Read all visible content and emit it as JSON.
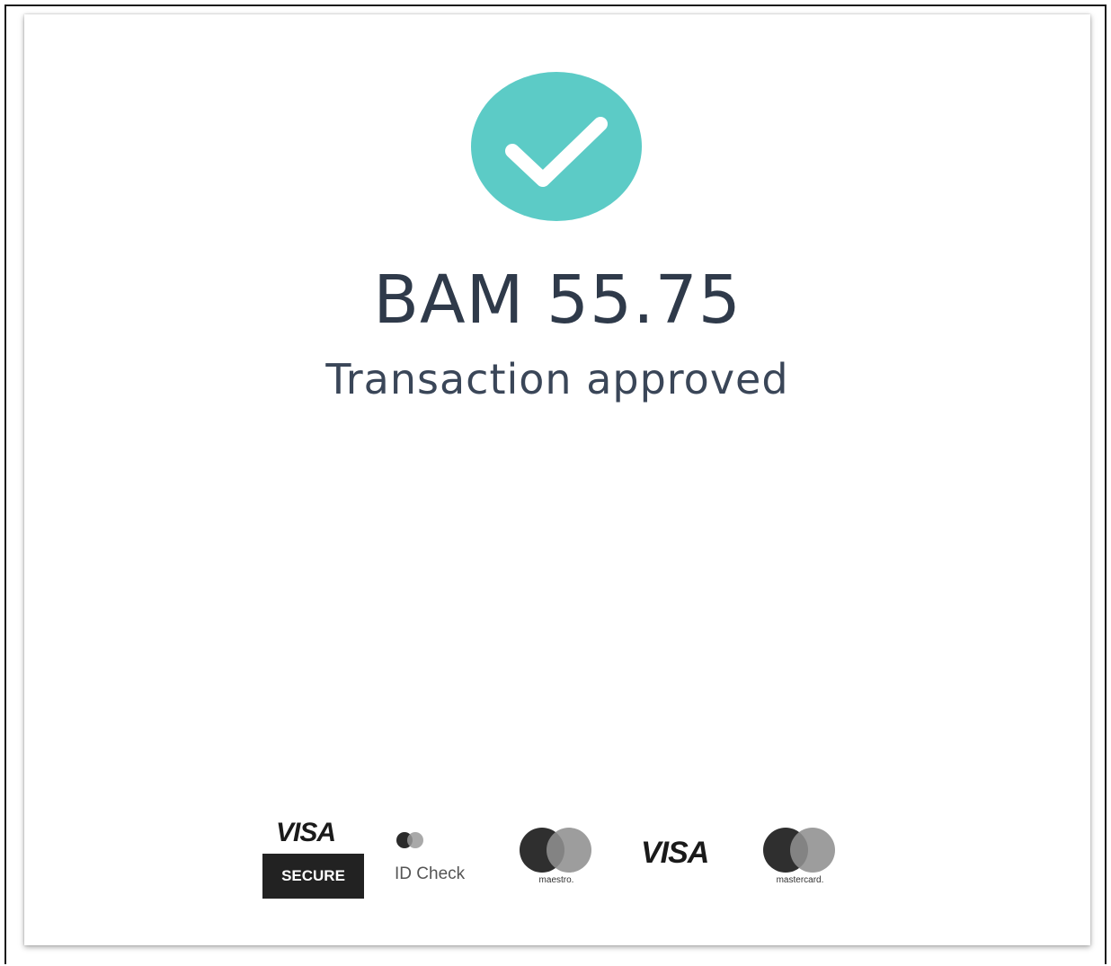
{
  "result": {
    "amount": "BAM 55.75",
    "status": "Transaction approved",
    "icon": "checkmark-icon",
    "accent_color": "#5ccbc6"
  },
  "footer_logos": {
    "visa_secure": {
      "brand": "VISA",
      "badge": "SECURE"
    },
    "id_check": {
      "label": "ID Check"
    },
    "maestro": {
      "caption": "maestro."
    },
    "visa": {
      "brand": "VISA"
    },
    "mastercard": {
      "caption": "mastercard."
    }
  }
}
